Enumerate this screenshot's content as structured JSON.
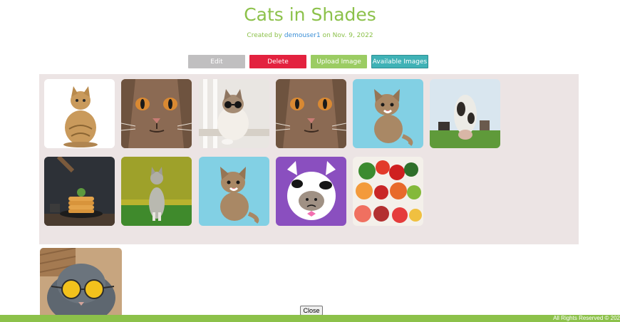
{
  "page": {
    "title": "Cats in Shades",
    "subtitle_prefix": "Created by",
    "author": "demouser1",
    "subtitle_suffix": "on Nov. 9, 2022"
  },
  "actions": {
    "edit": "Edit",
    "delete": "Delete",
    "upload": "Upload Image",
    "available": "Available Images"
  },
  "gallery": {
    "close": "Close",
    "images": [
      "cat-sitting-image",
      "cat-face-closeup-image",
      "cat-wearing-sunglasses-image",
      "cat-face-closeup-image",
      "kitten-blue-background-image",
      "cow-wide-angle-image",
      "pancakes-image",
      "cat-on-grass-image",
      "kitten-blue-background-image",
      "cat-in-cow-costume-image",
      "fruits-vegetables-image"
    ]
  },
  "collection": {
    "images": [
      "cat-with-round-sunglasses-image"
    ]
  },
  "footer": {
    "left": "",
    "right": "All Rights Reserved © 202"
  },
  "colors": {
    "brand_green": "#8cc14a",
    "delete_red": "#e3223f",
    "link_blue": "#3b8fd6",
    "teal": "#3fb2b6",
    "panel_bg": "#ece4e4"
  }
}
